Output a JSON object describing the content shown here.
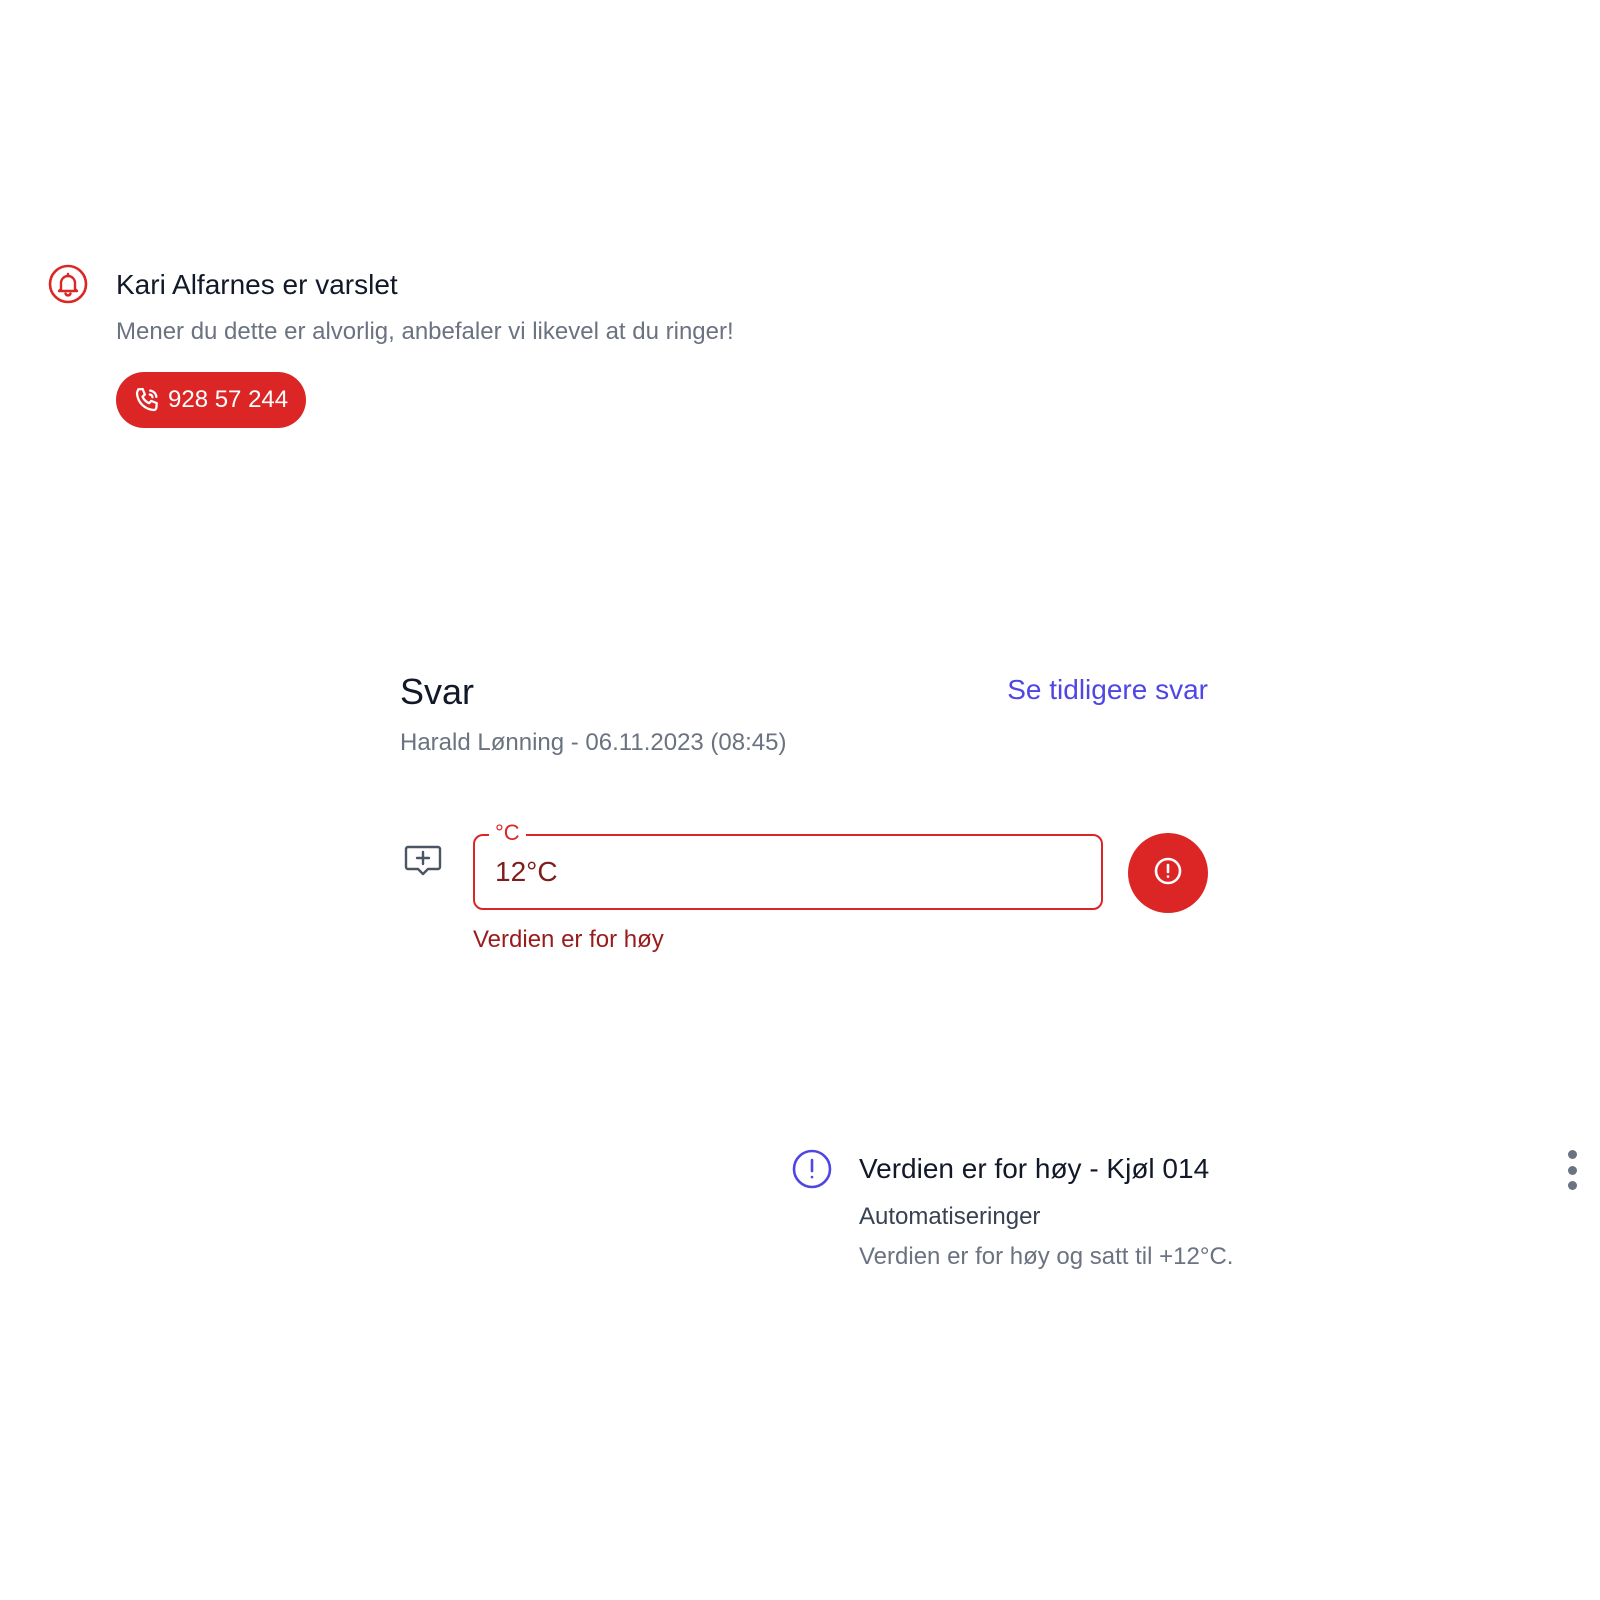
{
  "alert": {
    "icon": "bell-icon",
    "title": "Kari Alfarnes er varslet",
    "subtitle": "Mener du dette er alvorlig, anbefaler vi likevel at du ringer!",
    "call_button": {
      "icon": "phone-icon",
      "label": "928 57 244"
    },
    "accent_color": "#dc2626"
  },
  "answer": {
    "heading": "Svar",
    "history_link": "Se tidligere svar",
    "meta": "Harald Lønning - 06.11.2023 (08:45)",
    "comment_button_icon": "add-comment-icon",
    "field": {
      "legend": "°C",
      "value": "12°C",
      "error": "Verdien er for høy"
    },
    "status_button_icon": "alert-circle-icon",
    "error_color": "#dc2626",
    "link_color": "#4f46e5"
  },
  "notification": {
    "icon": "info-exclamation-icon",
    "title": "Verdien er for høy - Kjøl 014",
    "source": "Automatiseringer",
    "message": "Verdien er for høy og satt til +12°C.",
    "menu_icon": "more-vertical-icon",
    "accent_color": "#4f46e5"
  }
}
